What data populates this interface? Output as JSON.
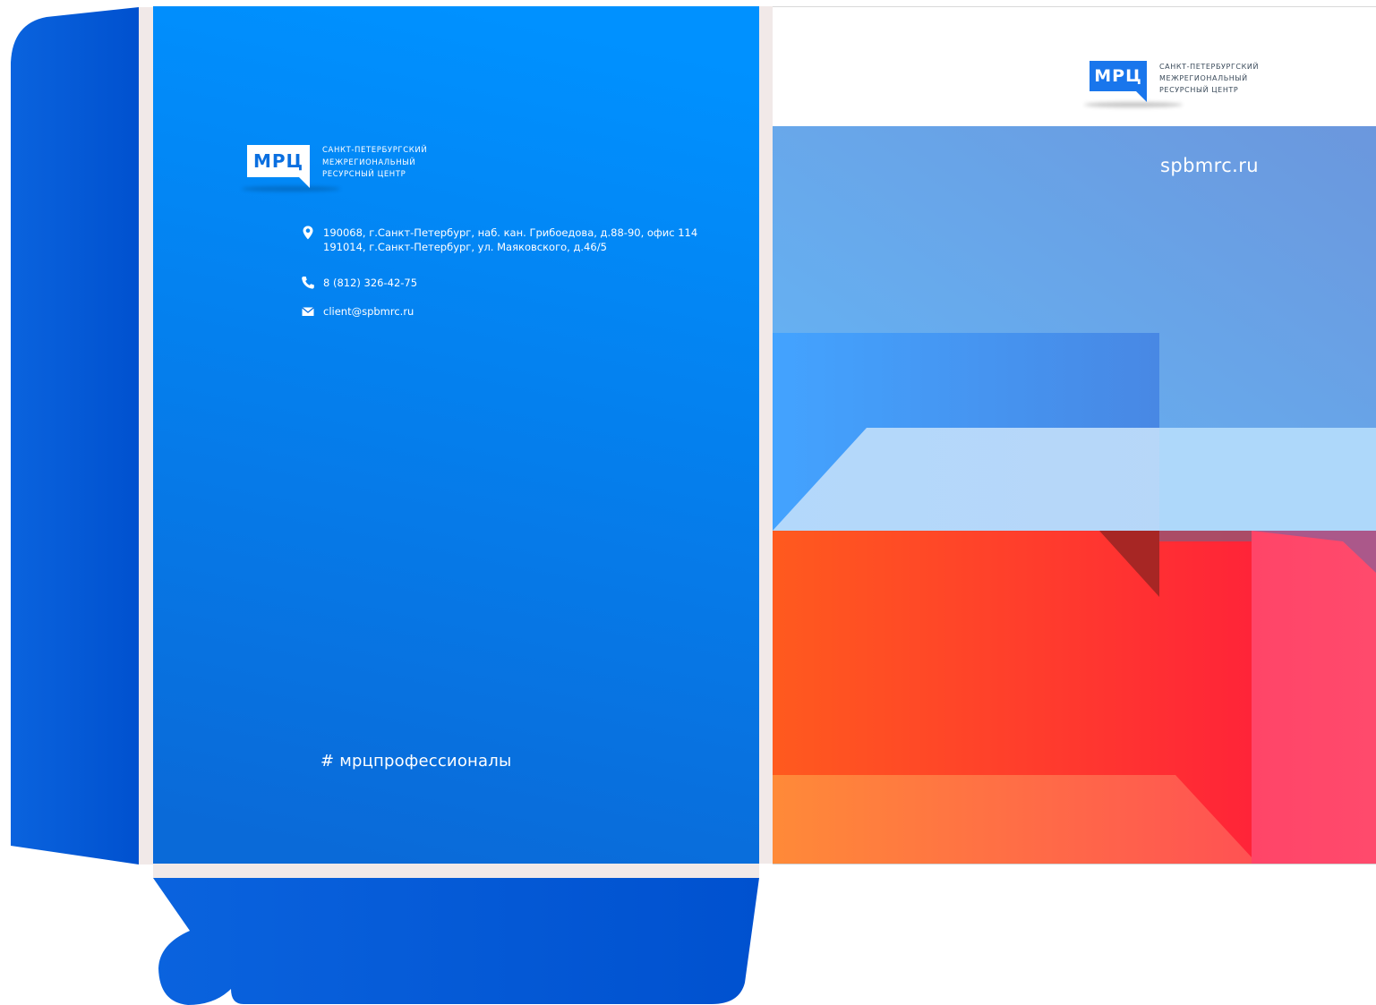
{
  "brand": {
    "mark": "МРЦ",
    "name_lines": [
      "Санкт-Петербургский",
      "межрегиональный",
      "ресурсный центр"
    ]
  },
  "contacts": {
    "address_lines": [
      "190068, г.Санкт-Петербург, наб. кан. Грибоедова, д.88-90, офис 114",
      "191014, г.Санкт-Петербург, ул. Маяковского, д.46/5"
    ],
    "phone": "8 (812) 326-42-75",
    "email": "client@spbmrc.ru",
    "icons": [
      "location-pin-icon",
      "phone-icon",
      "envelope-icon"
    ]
  },
  "hashtag": "# мрцпрофессионалы",
  "website": "spbmrc.ru",
  "colors": {
    "blue": "#0a6fe0",
    "flap_blue": "#0457d2",
    "red": "#ff3535",
    "orange": "#ff8a3a",
    "light_blue": "#b6dcff"
  }
}
